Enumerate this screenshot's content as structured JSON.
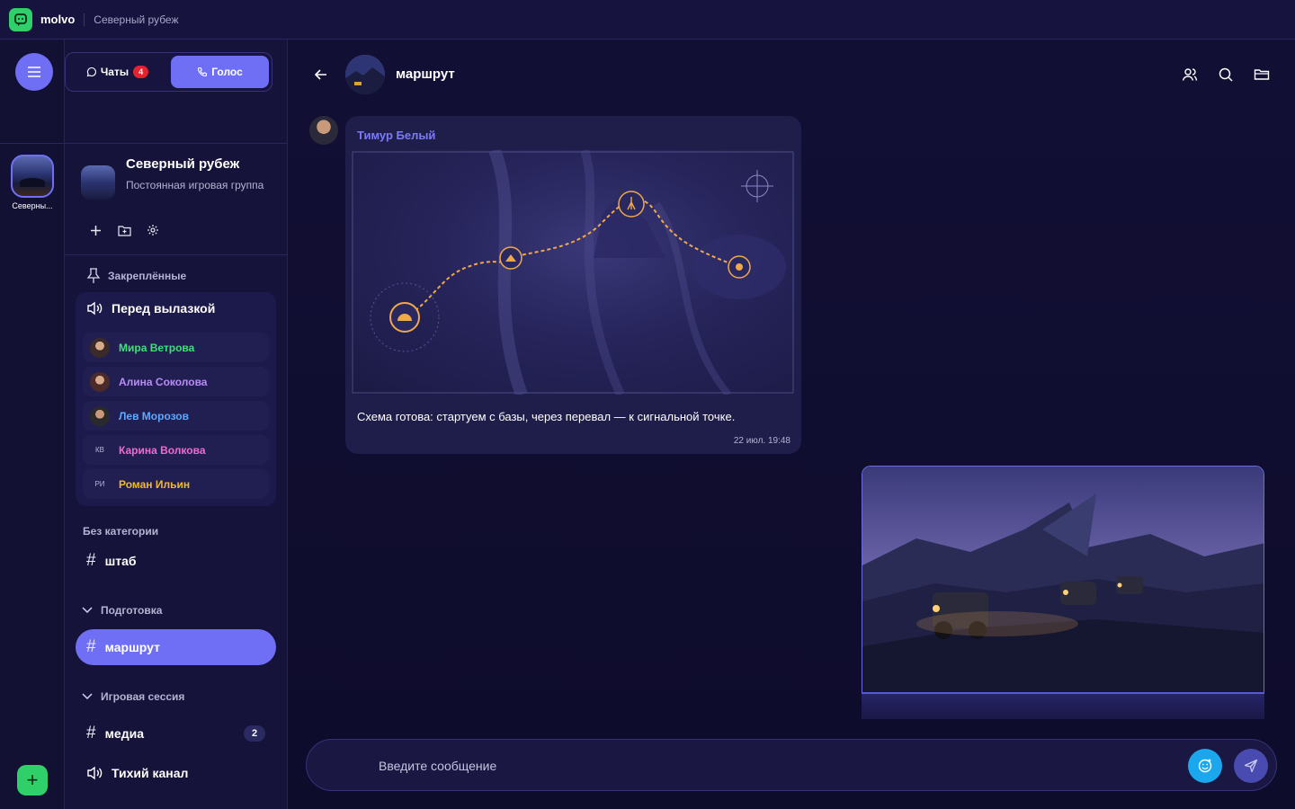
{
  "app": {
    "name": "molvo",
    "window_title": "Северный рубеж"
  },
  "rail": {
    "server_label": "Северны...",
    "menu_icon": "hamburger-icon",
    "add_icon": "plus-icon"
  },
  "tabs": {
    "chats_label": "Чаты",
    "chats_badge": "4",
    "voice_label": "Голос"
  },
  "group": {
    "name": "Северный рубеж",
    "subtitle": "Постоянная игровая группа"
  },
  "pinned": {
    "header": "Закреплённые",
    "voice_channel": "Перед вылазкой",
    "members": [
      {
        "name": "Мира Ветрова",
        "initials": "",
        "color": "#3ee07a"
      },
      {
        "name": "Алина Соколова",
        "initials": "",
        "color": "#b98cf5"
      },
      {
        "name": "Лев Морозов",
        "initials": "",
        "color": "#5fa8ff"
      },
      {
        "name": "Карина Волкова",
        "initials": "КВ",
        "color": "#ef6ad0"
      },
      {
        "name": "Роман Ильин",
        "initials": "РИ",
        "color": "#f3b92c"
      }
    ]
  },
  "categories": {
    "uncategorized": "Без категории",
    "prep": "Подготовка",
    "session": "Игровая сессия"
  },
  "channels": {
    "hq": "штаб",
    "route": "маршрут",
    "media": "медиа",
    "media_count": "2",
    "quiet": "Тихий канал"
  },
  "chat": {
    "title": "маршрут",
    "message": {
      "author": "Тимур Белый",
      "text": "Схема готова: стартуем с базы, через перевал — к сигнальной точке.",
      "time": "22 июл. 19:48"
    },
    "composer_placeholder": "Введите сообщение"
  },
  "colors": {
    "accent": "#6e6ff5",
    "brand": "#2fd06a",
    "badge": "#e5232f",
    "emoji_button": "#1aa7ee"
  }
}
